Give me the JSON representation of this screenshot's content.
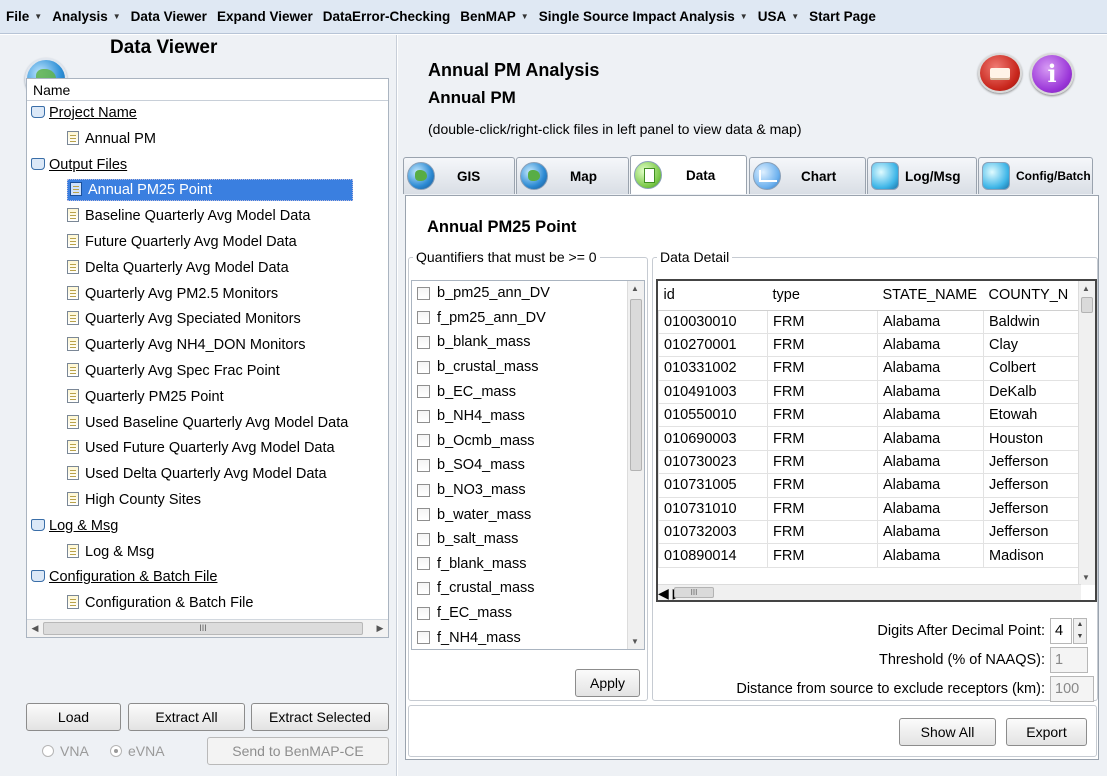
{
  "menu": [
    {
      "label": "File",
      "has_arrow": true
    },
    {
      "label": "Analysis",
      "has_arrow": true
    },
    {
      "label": "Data Viewer",
      "has_arrow": false
    },
    {
      "label": "Expand Viewer",
      "has_arrow": false
    },
    {
      "label": "DataError-Checking",
      "has_arrow": false
    },
    {
      "label": "BenMAP",
      "has_arrow": true
    },
    {
      "label": "Single Source Impact Analysis",
      "has_arrow": true
    },
    {
      "label": "USA",
      "has_arrow": true
    },
    {
      "label": "Start Page",
      "has_arrow": false
    }
  ],
  "left": {
    "title": "Data Viewer",
    "tree_header": "Name",
    "tree": [
      {
        "type": "group",
        "label": "Project Name"
      },
      {
        "type": "leaf",
        "label": "Annual PM"
      },
      {
        "type": "group",
        "label": "Output Files"
      },
      {
        "type": "leaf",
        "label": "Annual PM25 Point",
        "selected": true
      },
      {
        "type": "leaf",
        "label": "Baseline Quarterly Avg Model Data"
      },
      {
        "type": "leaf",
        "label": "Future Quarterly Avg Model Data"
      },
      {
        "type": "leaf",
        "label": "Delta Quarterly Avg Model Data"
      },
      {
        "type": "leaf",
        "label": "Quarterly Avg PM2.5 Monitors"
      },
      {
        "type": "leaf",
        "label": "Quarterly Avg Speciated Monitors"
      },
      {
        "type": "leaf",
        "label": "Quarterly Avg NH4_DON Monitors"
      },
      {
        "type": "leaf",
        "label": "Quarterly Avg Spec Frac Point"
      },
      {
        "type": "leaf",
        "label": "Quarterly PM25 Point"
      },
      {
        "type": "leaf",
        "label": "Used Baseline Quarterly Avg Model Data"
      },
      {
        "type": "leaf",
        "label": "Used Future Quarterly Avg Model Data"
      },
      {
        "type": "leaf",
        "label": "Used Delta Quarterly Avg Model Data"
      },
      {
        "type": "leaf",
        "label": "High County Sites"
      },
      {
        "type": "group",
        "label": "Log & Msg"
      },
      {
        "type": "leaf",
        "label": "Log & Msg"
      },
      {
        "type": "group",
        "label": "Configuration & Batch File"
      },
      {
        "type": "leaf",
        "label": "Configuration & Batch File"
      }
    ],
    "buttons": {
      "load": "Load",
      "extract_all": "Extract All",
      "extract_selected": "Extract Selected",
      "send": "Send to BenMAP-CE"
    },
    "radio": {
      "vna": "VNA",
      "evna": "eVNA",
      "selected": "eVNA"
    }
  },
  "header": {
    "title": "Annual PM Analysis",
    "subtitle": "Annual PM",
    "hint": "(double-click/right-click files in left panel to view data & map)"
  },
  "tabs": [
    {
      "label": "GIS",
      "icon": "globe-icon",
      "active": false
    },
    {
      "label": "Map",
      "icon": "globe-icon",
      "active": false
    },
    {
      "label": "Data",
      "icon": "document-icon",
      "active": true
    },
    {
      "label": "Chart",
      "icon": "chart-icon",
      "active": false
    },
    {
      "label": "Log/Msg",
      "icon": "cube-icon",
      "active": false
    },
    {
      "label": "Config/Batch",
      "icon": "cube-icon",
      "active": false
    }
  ],
  "data_panel": {
    "title": "Annual PM25 Point",
    "quantifiers_legend": "Quantifiers that must be >= 0",
    "quantifiers": [
      "b_pm25_ann_DV",
      "f_pm25_ann_DV",
      "b_blank_mass",
      "b_crustal_mass",
      "b_EC_mass",
      "b_NH4_mass",
      "b_Ocmb_mass",
      "b_SO4_mass",
      "b_NO3_mass",
      "b_water_mass",
      "b_salt_mass",
      "f_blank_mass",
      "f_crustal_mass",
      "f_EC_mass",
      "f_NH4_mass"
    ],
    "apply": "Apply",
    "detail_legend": "Data Detail",
    "columns": [
      "id",
      "type",
      "STATE_NAME",
      "COUNTY_N"
    ],
    "rows": [
      [
        "010030010",
        "FRM",
        "Alabama",
        "Baldwin"
      ],
      [
        "010270001",
        "FRM",
        "Alabama",
        "Clay"
      ],
      [
        "010331002",
        "FRM",
        "Alabama",
        "Colbert"
      ],
      [
        "010491003",
        "FRM",
        "Alabama",
        "DeKalb"
      ],
      [
        "010550010",
        "FRM",
        "Alabama",
        "Etowah"
      ],
      [
        "010690003",
        "FRM",
        "Alabama",
        "Houston"
      ],
      [
        "010730023",
        "FRM",
        "Alabama",
        "Jefferson"
      ],
      [
        "010731005",
        "FRM",
        "Alabama",
        "Jefferson"
      ],
      [
        "010731010",
        "FRM",
        "Alabama",
        "Jefferson"
      ],
      [
        "010732003",
        "FRM",
        "Alabama",
        "Jefferson"
      ],
      [
        "010890014",
        "FRM",
        "Alabama",
        "Madison"
      ]
    ],
    "digits_label": "Digits After Decimal Point:",
    "digits_value": "4",
    "threshold_label": "Threshold (% of NAAQS):",
    "threshold_value": "1",
    "distance_label": "Distance from source to exclude receptors (km):",
    "distance_value": "100",
    "show_all": "Show All",
    "export": "Export"
  }
}
